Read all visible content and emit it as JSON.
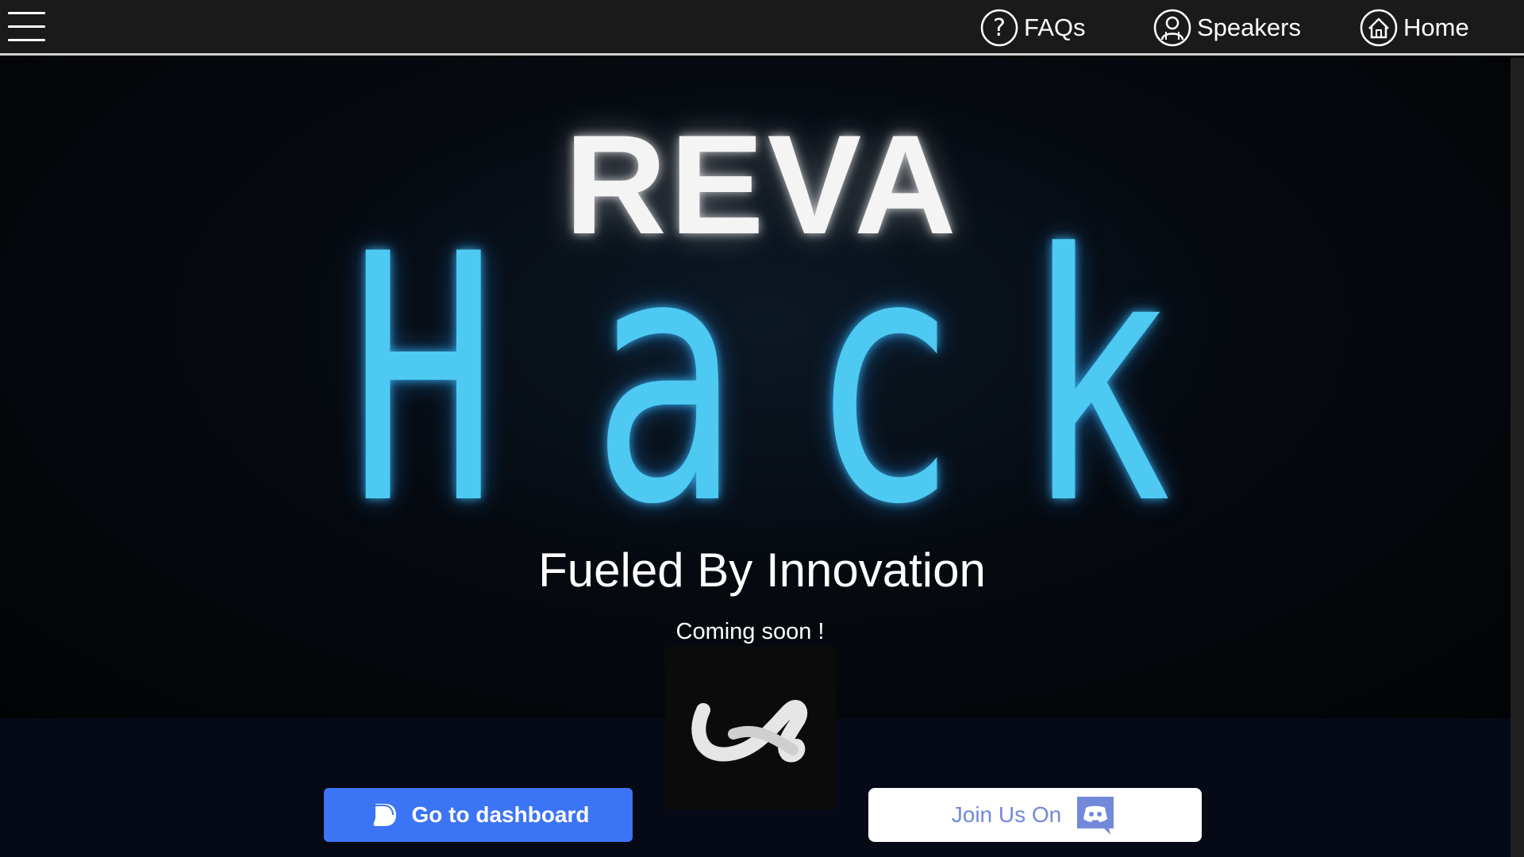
{
  "nav": {
    "items": [
      {
        "label": "FAQs",
        "icon": "help-circle-icon"
      },
      {
        "label": "Speakers",
        "icon": "user-circle-icon"
      },
      {
        "label": "Home",
        "icon": "home-icon"
      }
    ],
    "menu_icon": "hamburger-menu-icon"
  },
  "hero": {
    "brand": "REVA",
    "title_letters": [
      "H",
      "a",
      "c",
      "k"
    ],
    "tagline": "Fueled By Innovation",
    "status": "Coming soon !",
    "logo_icon": "event-logo-icon"
  },
  "actions": {
    "dashboard_label": "Go to dashboard",
    "dashboard_icon": "devfolio-icon",
    "discord_label": "Join Us On",
    "discord_icon": "discord-icon"
  },
  "colors": {
    "accent_blue": "#4ec9f2",
    "button_blue": "#3b74f5",
    "discord_purple": "#7289da",
    "topbar": "#1a1a1a"
  }
}
